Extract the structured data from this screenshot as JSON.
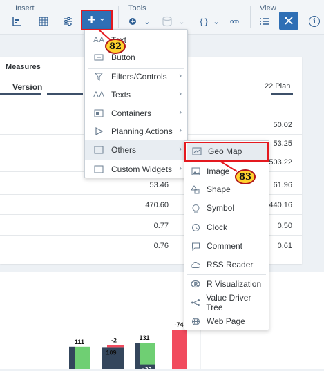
{
  "toolbar": {
    "insert_label": "Insert",
    "tools_label": "Tools",
    "view_label": "View",
    "add_plus": "+",
    "add_chevron": "⌄",
    "braces_label": "{ }",
    "chevron": "⌄",
    "more_label": "ooo",
    "info_label": "i"
  },
  "callouts": {
    "first": "82",
    "second": "83"
  },
  "table": {
    "measures_label": "Measures",
    "version_label": "Version",
    "plan_label": "22 Plan",
    "rows": [
      {
        "mid": "",
        "right": "50.02"
      },
      {
        "mid": "",
        "right": "53.25"
      },
      {
        "mid": "",
        "right": "503.22"
      },
      {
        "mid": "53.46",
        "right": "61.96"
      },
      {
        "mid": "470.60",
        "right": "440.16"
      },
      {
        "mid": "0.77",
        "right": "0.50"
      },
      {
        "mid": "0.76",
        "right": "0.61"
      }
    ]
  },
  "insert_menu": {
    "items": [
      {
        "label": "Text",
        "icon": "text-icon"
      },
      {
        "label": "Button",
        "icon": "button-icon"
      },
      {
        "label": "Filters/Controls",
        "icon": "filter-icon",
        "submenu": true
      },
      {
        "label": "Texts",
        "icon": "text-icon",
        "submenu": true
      },
      {
        "label": "Containers",
        "icon": "containers-icon",
        "submenu": true
      },
      {
        "label": "Planning Actions",
        "icon": "play-icon",
        "submenu": true
      },
      {
        "label": "Others",
        "icon": "folder-icon",
        "submenu": true,
        "highlighted": true
      },
      {
        "label": "Custom Widgets",
        "icon": "folder-icon",
        "submenu": true
      }
    ]
  },
  "others_menu": {
    "items": [
      {
        "label": "Geo Map",
        "icon": "geo-map-icon",
        "highlighted": true
      },
      {
        "label": "Image",
        "icon": "image-icon"
      },
      {
        "label": "Shape",
        "icon": "shape-icon"
      },
      {
        "label": "Symbol",
        "icon": "symbol-icon"
      },
      {
        "label": "Clock",
        "icon": "clock-icon"
      },
      {
        "label": "Comment",
        "icon": "comment-icon"
      },
      {
        "label": "RSS Reader",
        "icon": "cloud-icon"
      },
      {
        "label": "R Visualization",
        "icon": "r-icon"
      },
      {
        "label": "Value Driver Tree",
        "icon": "tree-icon"
      },
      {
        "label": "Web Page",
        "icon": "globe-icon"
      }
    ]
  },
  "chart": {
    "bars": [
      {
        "value": 111,
        "label": "111"
      },
      {
        "value": -2,
        "label": "-2",
        "inner_label": "109"
      },
      {
        "value": 131,
        "label": "131",
        "inner_label": "+22"
      },
      {
        "value": -74,
        "label": "-74"
      }
    ],
    "colors": {
      "dark": "#34465c",
      "green": "#6fcf73",
      "red": "#f14b5e"
    }
  }
}
